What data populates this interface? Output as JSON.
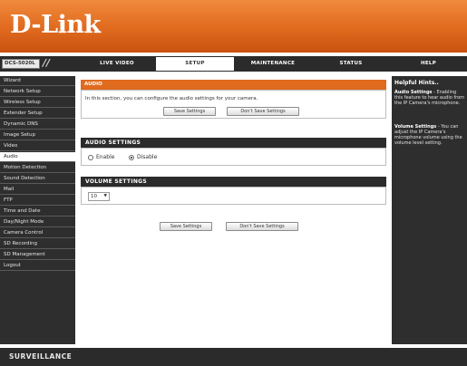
{
  "brand": {
    "logo": "D-Link"
  },
  "nav": {
    "model": "DCS-5020L",
    "tabs": [
      {
        "label": "LIVE VIDEO",
        "active": false
      },
      {
        "label": "SETUP",
        "active": true
      },
      {
        "label": "MAINTENANCE",
        "active": false
      },
      {
        "label": "STATUS",
        "active": false
      },
      {
        "label": "HELP",
        "active": false
      }
    ]
  },
  "sidebar": {
    "items": [
      {
        "label": "Wizard"
      },
      {
        "label": "Network Setup"
      },
      {
        "label": "Wireless Setup"
      },
      {
        "label": "Extender Setup"
      },
      {
        "label": "Dynamic DNS"
      },
      {
        "label": "Image Setup"
      },
      {
        "label": "Video"
      },
      {
        "label": "Audio",
        "active": true
      },
      {
        "label": "Motion Detection"
      },
      {
        "label": "Sound Detection"
      },
      {
        "label": "Mail"
      },
      {
        "label": "FTP"
      },
      {
        "label": "Time and Date"
      },
      {
        "label": "Day/Night Mode"
      },
      {
        "label": "Camera Control"
      },
      {
        "label": "SD Recording"
      },
      {
        "label": "SD Management"
      },
      {
        "label": "Logout"
      }
    ]
  },
  "main": {
    "section_title": "AUDIO",
    "intro": "In this section, you can configure the audio settings for your camera.",
    "save_label": "Save Settings",
    "dont_save_label": "Don't Save Settings",
    "audio_settings": {
      "title": "AUDIO SETTINGS",
      "enable_label": "Enable",
      "disable_label": "Disable",
      "selected": "Disable"
    },
    "volume_settings": {
      "title": "VOLUME SETTINGS",
      "value": "10"
    }
  },
  "help": {
    "title": "Helpful Hints..",
    "audio_term": "Audio Settings",
    "audio_text": " - Enabling this feature to hear audio from the IP Camera's microphone.",
    "volume_term": "Volume Settings",
    "volume_text": " - You can adjust the IP Camera's microphone volume using the volume level setting."
  },
  "footer": {
    "text": "SURVEILLANCE"
  },
  "colors": {
    "accent": "#e06a1e",
    "dark": "#2b2b2b"
  }
}
